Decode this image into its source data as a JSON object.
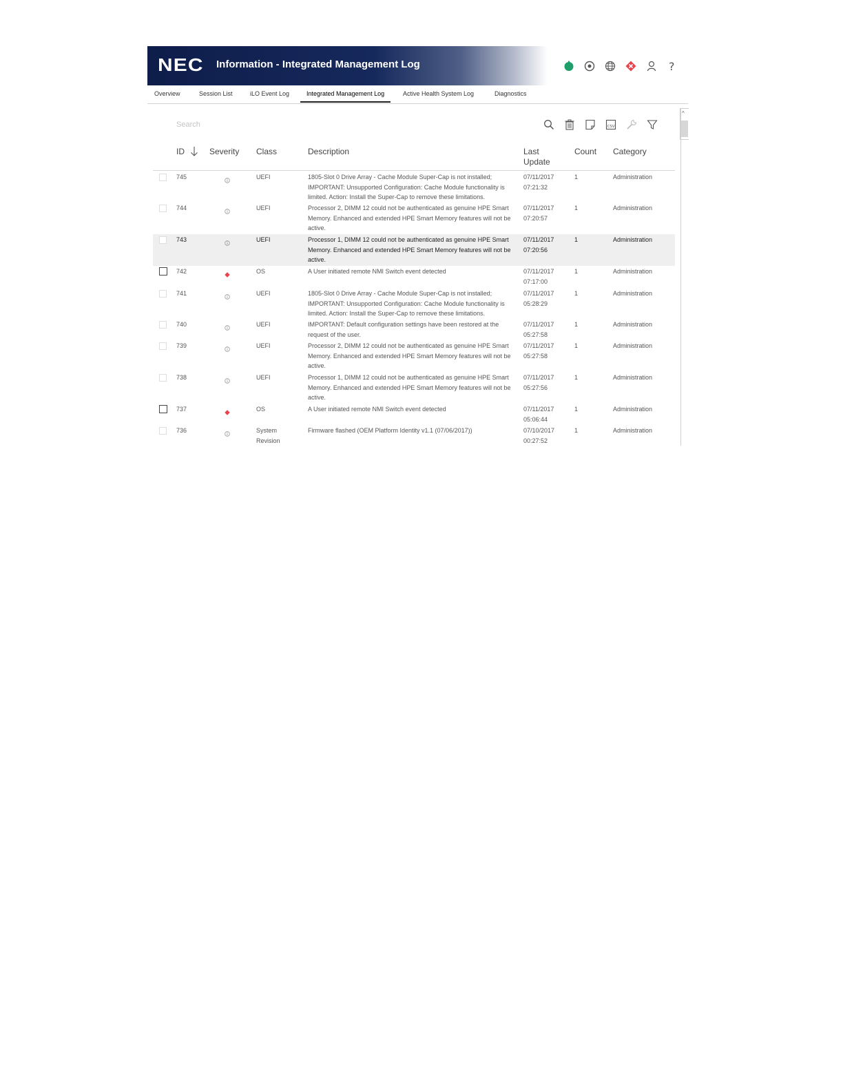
{
  "header": {
    "logo": "NEC",
    "title": "Information - Integrated Management Log"
  },
  "colors": {
    "header_dark": "#0e1d4a",
    "health_ok": "#1e9e6b",
    "critical": "#e8434f"
  },
  "status_icons": [
    "health-ok-icon",
    "target-icon",
    "globe-icon",
    "alert-icon",
    "user-icon",
    "help-icon"
  ],
  "tabs": [
    {
      "label": "Overview"
    },
    {
      "label": "Session List"
    },
    {
      "label": "iLO Event Log"
    },
    {
      "label": "Integrated Management Log",
      "active": true
    },
    {
      "label": "Active Health System Log"
    },
    {
      "label": "Diagnostics"
    }
  ],
  "search": {
    "placeholder": "Search"
  },
  "toolbar": [
    "search-icon",
    "delete-icon",
    "note-icon",
    "csv-export-icon",
    "wrench-icon",
    "filter-icon"
  ],
  "columns": {
    "id": "ID",
    "severity": "Severity",
    "class": "Class",
    "description": "Description",
    "last_update_1": "Last",
    "last_update_2": "Update",
    "count": "Count",
    "category": "Category"
  },
  "rows": [
    {
      "id": "745",
      "severity": "informational",
      "class": "UEFI",
      "description": "1805-Slot 0 Drive Array - Cache Module Super-Cap is not installed; IMPORTANT: Unsupported Configuration: Cache Module functionality is limited. Action: Install the Super-Cap to remove these limitations.",
      "date": "07/11/2017",
      "time": "07:21:32",
      "count": "1",
      "category": "Administration"
    },
    {
      "id": "744",
      "severity": "informational",
      "class": "UEFI",
      "description": "Processor 2, DIMM 12 could not be authenticated as genuine HPE Smart Memory. Enhanced and extended HPE Smart Memory features will not be active.",
      "date": "07/11/2017",
      "time": "07:20:57",
      "count": "1",
      "category": "Administration"
    },
    {
      "id": "743",
      "severity": "informational",
      "class": "UEFI",
      "description": "Processor 1, DIMM 12 could not be authenticated as genuine HPE Smart Memory. Enhanced and extended HPE Smart Memory features will not be active.",
      "date": "07/11/2017",
      "time": "07:20:56",
      "count": "1",
      "category": "Administration"
    },
    {
      "id": "742",
      "severity": "critical",
      "class": "OS",
      "description": "A User initiated remote NMI Switch event detected",
      "date": "07/11/2017",
      "time": "07:17:00",
      "count": "1",
      "category": "Administration"
    },
    {
      "id": "741",
      "severity": "informational",
      "class": "UEFI",
      "description": "1805-Slot 0 Drive Array - Cache Module Super-Cap is not installed; IMPORTANT: Unsupported Configuration: Cache Module functionality is limited. Action: Install the Super-Cap to remove these limitations.",
      "date": "07/11/2017",
      "time": "05:28:29",
      "count": "1",
      "category": "Administration"
    },
    {
      "id": "740",
      "severity": "informational",
      "class": "UEFI",
      "description": "IMPORTANT: Default configuration settings have been restored at the request of the user.",
      "date": "07/11/2017",
      "time": "05:27:58",
      "count": "1",
      "category": "Administration"
    },
    {
      "id": "739",
      "severity": "informational",
      "class": "UEFI",
      "description": "Processor 2, DIMM 12 could not be authenticated as genuine HPE Smart Memory. Enhanced and extended HPE Smart Memory features will not be active.",
      "date": "07/11/2017",
      "time": "05:27:58",
      "count": "1",
      "category": "Administration"
    },
    {
      "id": "738",
      "severity": "informational",
      "class": "UEFI",
      "description": "Processor 1, DIMM 12 could not be authenticated as genuine HPE Smart Memory. Enhanced and extended HPE Smart Memory features will not be active.",
      "date": "07/11/2017",
      "time": "05:27:56",
      "count": "1",
      "category": "Administration"
    },
    {
      "id": "737",
      "severity": "critical",
      "class": "OS",
      "description": "A User initiated remote NMI Switch event detected",
      "date": "07/11/2017",
      "time": "05:06:44",
      "count": "1",
      "category": "Administration"
    },
    {
      "id": "736",
      "severity": "informational",
      "class": "System Revision",
      "description": "Firmware flashed (OEM Platform Identity v1.1 (07/06/2017))",
      "date": "07/10/2017",
      "time": "00:27:52",
      "count": "1",
      "category": "Administration"
    }
  ]
}
